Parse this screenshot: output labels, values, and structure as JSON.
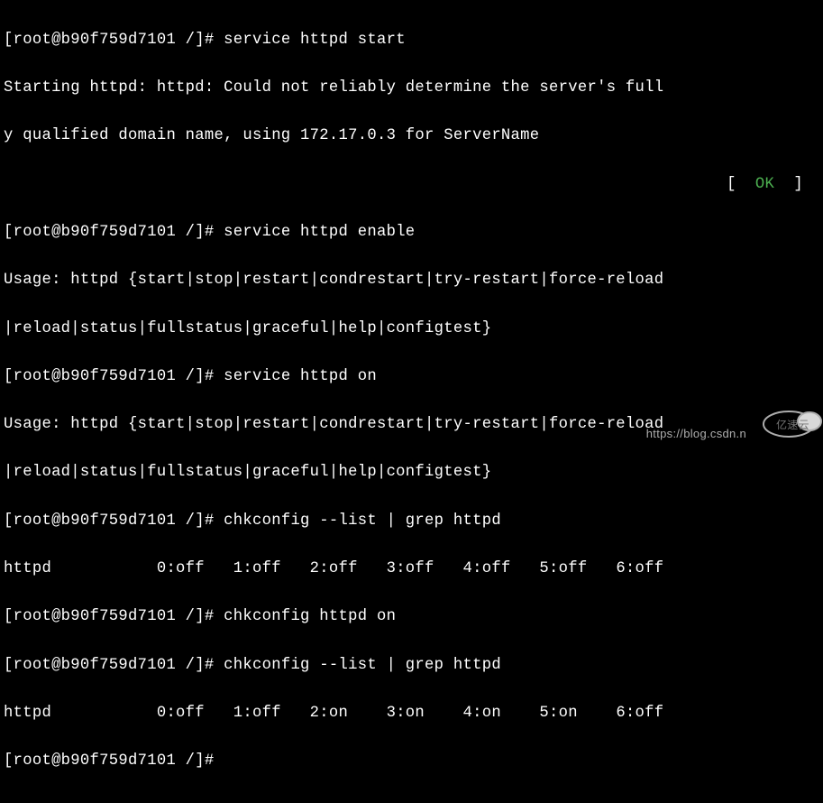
{
  "prompt": "[root@b90f759d7101 /]# ",
  "lines": {
    "cmd1": "service httpd start",
    "out1a": "Starting httpd: httpd: Could not reliably determine the server's full",
    "out1b": "y qualified domain name, using 172.17.0.3 for ServerName",
    "status_open": "[  ",
    "status_ok": "OK",
    "status_close": "  ]",
    "cmd2": "service httpd enable",
    "usage1a": "Usage: httpd {start|stop|restart|condrestart|try-restart|force-reload",
    "usage1b": "|reload|status|fullstatus|graceful|help|configtest}",
    "cmd3": "service httpd on",
    "usage2a": "Usage: httpd {start|stop|restart|condrestart|try-restart|force-reload",
    "usage2b": "|reload|status|fullstatus|graceful|help|configtest}",
    "cmd4": "chkconfig --list | grep httpd",
    "chk1": "httpd          \t0:off\t1:off\t2:off\t3:off\t4:off\t5:off\t6:off",
    "cmd5": "chkconfig httpd on",
    "cmd6": "chkconfig --list | grep httpd",
    "chk2": "httpd          \t0:off\t1:off\t2:on\t3:on\t4:on\t5:on\t6:off",
    "cmd7": ""
  },
  "watermark": {
    "text": "https://blog.csdn.n",
    "logo": "亿速云"
  }
}
